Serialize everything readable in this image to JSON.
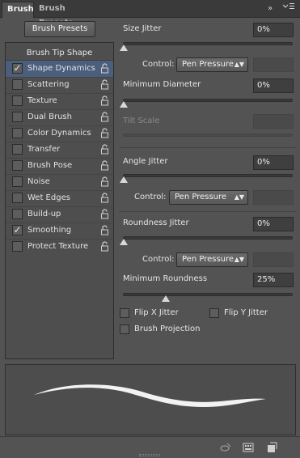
{
  "tabs": [
    {
      "label": "Brush",
      "active": true
    },
    {
      "label": "Brush Presets",
      "active": false
    }
  ],
  "tabbar_buttons": {
    "collapse_icon": "double-chevron-right-icon",
    "menu_icon": "panel-menu-icon"
  },
  "left": {
    "presets_button": "Brush Presets",
    "tip_shape": "Brush Tip Shape",
    "options": [
      {
        "label": "Shape Dynamics",
        "checked": true,
        "selected": true
      },
      {
        "label": "Scattering",
        "checked": false,
        "selected": false
      },
      {
        "label": "Texture",
        "checked": false,
        "selected": false
      },
      {
        "label": "Dual Brush",
        "checked": false,
        "selected": false
      },
      {
        "label": "Color Dynamics",
        "checked": false,
        "selected": false
      },
      {
        "label": "Transfer",
        "checked": false,
        "selected": false
      },
      {
        "label": "Brush Pose",
        "checked": false,
        "selected": false
      },
      {
        "label": "Noise",
        "checked": false,
        "selected": false
      },
      {
        "label": "Wet Edges",
        "checked": false,
        "selected": false
      },
      {
        "label": "Build-up",
        "checked": false,
        "selected": false
      },
      {
        "label": "Smoothing",
        "checked": true,
        "selected": false
      },
      {
        "label": "Protect Texture",
        "checked": false,
        "selected": false
      }
    ]
  },
  "right": {
    "size_jitter": {
      "label": "Size Jitter",
      "value": "0%",
      "slider": 0
    },
    "control_1": {
      "label": "Control:",
      "value": "Pen Pressure"
    },
    "min_diameter": {
      "label": "Minimum Diameter",
      "value": "0%",
      "slider": 0
    },
    "tilt_scale": {
      "label": "Tilt Scale"
    },
    "angle_jitter": {
      "label": "Angle Jitter",
      "value": "0%",
      "slider": 0
    },
    "control_2": {
      "label": "Control:",
      "value": "Pen Pressure"
    },
    "roundness_jitter": {
      "label": "Roundness Jitter",
      "value": "0%",
      "slider": 0
    },
    "control_3": {
      "label": "Control:",
      "value": "Pen Pressure"
    },
    "min_roundness": {
      "label": "Minimum Roundness",
      "value": "25%",
      "slider": 0.25
    },
    "flip_x": {
      "label": "Flip X Jitter",
      "checked": false
    },
    "flip_y": {
      "label": "Flip Y Jitter",
      "checked": false
    },
    "projection": {
      "label": "Brush Projection",
      "checked": false
    }
  },
  "bottom_icons": [
    "toggle-live-tip-icon",
    "brush-preview-grid-icon",
    "new-preset-icon"
  ],
  "colors": {
    "panel": "#535353",
    "selected_row": "#4b5f7d",
    "field": "#3f3f3f"
  }
}
